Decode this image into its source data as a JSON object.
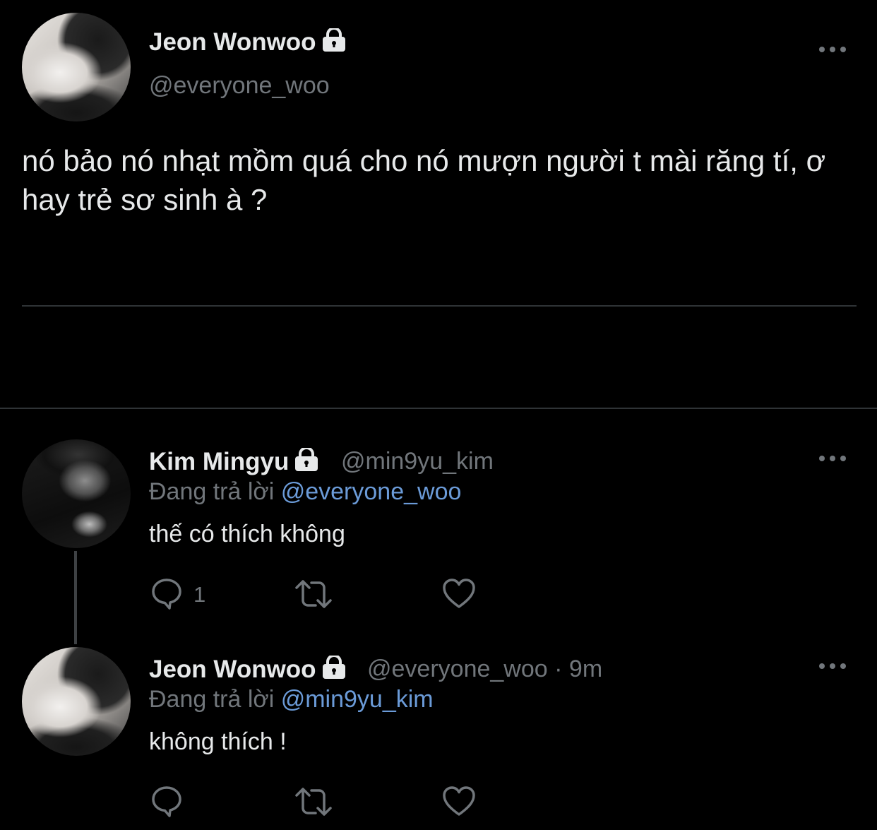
{
  "main_tweet": {
    "author_name": "Jeon Wonwoo",
    "author_handle": "@everyone_woo",
    "text": "nó bảo nó nhạt mồm quá cho nó mượn người t mài răng tí, ơ hay trẻ sơ sinh à ?"
  },
  "replies": [
    {
      "author_name": "Kim Mingyu",
      "author_handle": "@min9yu_kim",
      "replying_prefix": "Đang trả lời",
      "replying_to": "@everyone_woo",
      "text": "thế có thích không",
      "reply_count": "1"
    },
    {
      "author_name": "Jeon Wonwoo",
      "author_handle": "@everyone_woo",
      "separator": "·",
      "time": "9m",
      "replying_prefix": "Đang trả lời",
      "replying_to": "@min9yu_kim",
      "text": "không thích !"
    }
  ],
  "icons": {
    "protected": "lock-icon",
    "more": "more-icon",
    "reply": "reply-icon",
    "retweet": "retweet-icon",
    "like": "heart-icon"
  },
  "colors": {
    "background": "#000000",
    "text": "#e7e9ea",
    "muted": "#71767b",
    "link": "#6b9bd8",
    "divider": "#2f3336"
  }
}
